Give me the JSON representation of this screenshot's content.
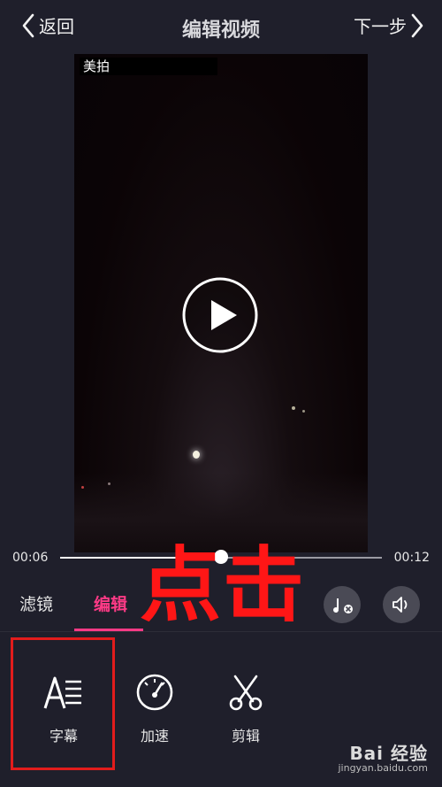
{
  "header": {
    "back_label": "返回",
    "title": "编辑视频",
    "next_label": "下一步"
  },
  "video": {
    "watermark": "美拍"
  },
  "playback": {
    "current_time": "00:06",
    "total_time": "00:12",
    "progress": 0.5
  },
  "tabs": [
    {
      "label": "滤镜",
      "active": false
    },
    {
      "label": "编辑",
      "active": true
    }
  ],
  "overlay_annotation": "点击",
  "tools": [
    {
      "label": "字幕",
      "icon": "subtitle-icon"
    },
    {
      "label": "加速",
      "icon": "speedometer-icon"
    },
    {
      "label": "剪辑",
      "icon": "scissors-icon"
    }
  ],
  "watermark_site": {
    "brand": "Bai 经验",
    "url": "jingyan.baidu.com"
  },
  "colors": {
    "background": "#1f1f2b",
    "accent": "#ff3a86",
    "annotation_red": "#ff1616"
  }
}
